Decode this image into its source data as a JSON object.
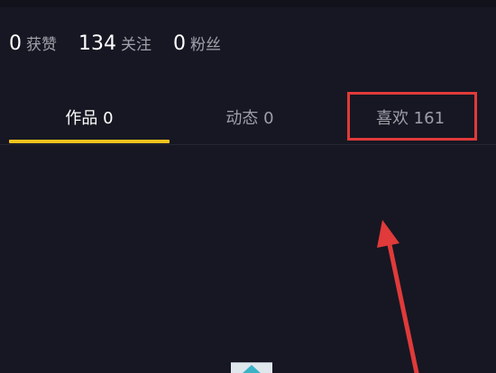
{
  "stats": [
    {
      "value": "0",
      "label": "获赞"
    },
    {
      "value": "134",
      "label": "关注"
    },
    {
      "value": "0",
      "label": "粉丝"
    }
  ],
  "tabs": [
    {
      "label": "作品 0",
      "active": true
    },
    {
      "label": "动态 0",
      "active": false
    },
    {
      "label": "喜欢 161",
      "active": false
    }
  ],
  "colors": {
    "background": "#161722",
    "active_indicator": "#f4c21e",
    "annotation": "#e03a3a",
    "inactive_text": "#9d9ea8"
  },
  "icons": {
    "annotation_arrow": "arrow-up-icon",
    "thumbnail": "thumbnail-icon"
  }
}
